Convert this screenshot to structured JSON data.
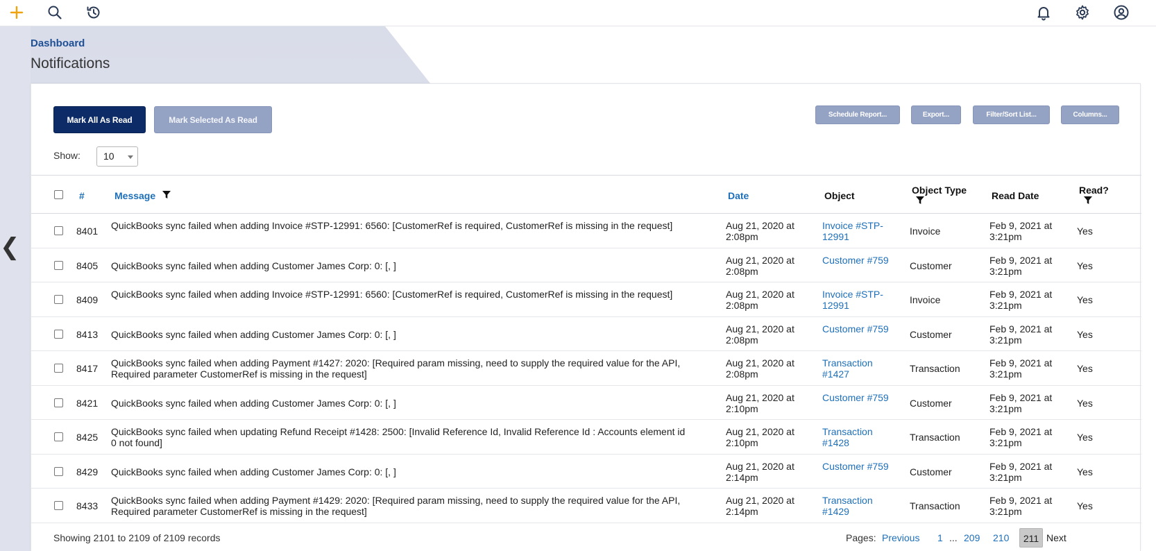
{
  "topbar": {
    "icons": [
      "plus-icon",
      "search-icon",
      "history-icon",
      "bell-icon",
      "gear-icon",
      "user-icon"
    ]
  },
  "breadcrumb": "Dashboard",
  "page_title": "Notifications",
  "actions": {
    "mark_all": "Mark All As Read",
    "mark_selected": "Mark Selected As Read",
    "schedule_report": "Schedule Report...",
    "export": "Export...",
    "filter_sort": "Filter/Sort List...",
    "columns": "Columns..."
  },
  "show": {
    "label": "Show:",
    "value": "10"
  },
  "table": {
    "headers": {
      "num": "#",
      "message": "Message",
      "date": "Date",
      "object": "Object",
      "object_type": "Object Type",
      "read_date": "Read Date",
      "read": "Read?"
    },
    "rows": [
      {
        "id": "8401",
        "message": "QuickBooks sync failed when adding Invoice #STP-12991: 6560: [CustomerRef is required, CustomerRef is missing in the request]",
        "date": "Aug 21, 2020 at 2:08pm",
        "object": "Invoice #STP-12991",
        "object_type": "Invoice",
        "read_date": "Feb 9, 2021 at 3:21pm",
        "read": "Yes"
      },
      {
        "id": "8405",
        "message": "QuickBooks sync failed when adding Customer James Corp: 0: [, ]",
        "date": "Aug 21, 2020 at 2:08pm",
        "object": "Customer #759",
        "object_type": "Customer",
        "read_date": "Feb 9, 2021 at 3:21pm",
        "read": "Yes"
      },
      {
        "id": "8409",
        "message": "QuickBooks sync failed when adding Invoice #STP-12991: 6560: [CustomerRef is required, CustomerRef is missing in the request]",
        "date": "Aug 21, 2020 at 2:08pm",
        "object": "Invoice #STP-12991",
        "object_type": "Invoice",
        "read_date": "Feb 9, 2021 at 3:21pm",
        "read": "Yes"
      },
      {
        "id": "8413",
        "message": "QuickBooks sync failed when adding Customer James Corp: 0: [, ]",
        "date": "Aug 21, 2020 at 2:08pm",
        "object": "Customer #759",
        "object_type": "Customer",
        "read_date": "Feb 9, 2021 at 3:21pm",
        "read": "Yes"
      },
      {
        "id": "8417",
        "message": "QuickBooks sync failed when adding Payment #1427: 2020: [Required param missing, need to supply the required value for the API, Required parameter CustomerRef is missing in the request]",
        "date": "Aug 21, 2020 at 2:08pm",
        "object": "Transaction #1427",
        "object_type": "Transaction",
        "read_date": "Feb 9, 2021 at 3:21pm",
        "read": "Yes"
      },
      {
        "id": "8421",
        "message": "QuickBooks sync failed when adding Customer James Corp: 0: [, ]",
        "date": "Aug 21, 2020 at 2:10pm",
        "object": "Customer #759",
        "object_type": "Customer",
        "read_date": "Feb 9, 2021 at 3:21pm",
        "read": "Yes"
      },
      {
        "id": "8425",
        "message": "QuickBooks sync failed when updating Refund Receipt #1428: 2500: [Invalid Reference Id, Invalid Reference Id : Accounts element id 0 not found]",
        "date": "Aug 21, 2020 at 2:10pm",
        "object": "Transaction #1428",
        "object_type": "Transaction",
        "read_date": "Feb 9, 2021 at 3:21pm",
        "read": "Yes"
      },
      {
        "id": "8429",
        "message": "QuickBooks sync failed when adding Customer James Corp: 0: [, ]",
        "date": "Aug 21, 2020 at 2:14pm",
        "object": "Customer #759",
        "object_type": "Customer",
        "read_date": "Feb 9, 2021 at 3:21pm",
        "read": "Yes"
      },
      {
        "id": "8433",
        "message": "QuickBooks sync failed when adding Payment #1429: 2020: [Required param missing, need to supply the required value for the API, Required parameter CustomerRef is missing in the request]",
        "date": "Aug 21, 2020 at 2:14pm",
        "object": "Transaction #1429",
        "object_type": "Transaction",
        "read_date": "Feb 9, 2021 at 3:21pm",
        "read": "Yes"
      }
    ]
  },
  "footer": {
    "showing": "Showing 2101 to 2109 of 2109 records",
    "pages_label": "Pages:",
    "previous": "Previous",
    "page_1": "1",
    "ellipsis": "...",
    "page_209": "209",
    "page_210": "210",
    "page_current": "211",
    "next": "Next"
  },
  "colors": {
    "accent": "#f0a30a",
    "primary": "#0d2b66",
    "link": "#1d6fb9",
    "muted_button": "#94a2c4"
  }
}
